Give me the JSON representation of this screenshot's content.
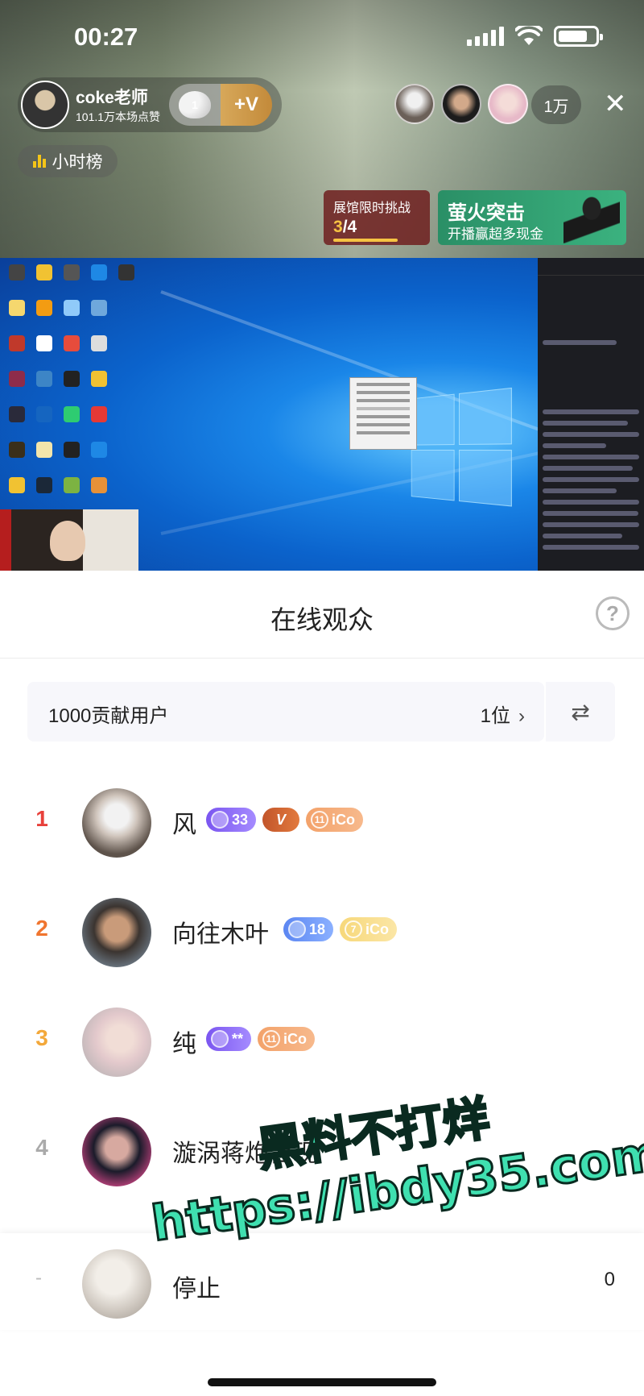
{
  "status_bar": {
    "time": "00:27"
  },
  "host": {
    "name": "coke老师",
    "sub": "101.1万本场点赞",
    "like_level": "1",
    "follow_label": "+V"
  },
  "viewer_count": "1万",
  "hour_rank_label": "小时榜",
  "challenge": {
    "title": "展馆限时挑战",
    "progress_done": "3",
    "progress_total": "/4"
  },
  "promo": {
    "title": "萤火突击",
    "subtitle": "开播赢超多现金"
  },
  "sheet": {
    "title": "在线观众",
    "contributors_label": "1000贡献用户",
    "contributors_count": "1位",
    "rows": [
      {
        "rank": "1",
        "name": "风",
        "level": "33",
        "vip": "V",
        "coin_label": "iCo",
        "coin_num": "11"
      },
      {
        "rank": "2",
        "name": "向往木叶",
        "level": "18",
        "coin_label": "iCo",
        "coin_num": "7"
      },
      {
        "rank": "3",
        "name": "纯",
        "level": "**",
        "coin_label": "iCo",
        "coin_num": "11"
      },
      {
        "rank": "4",
        "name": "漩涡蒋炮台现"
      }
    ],
    "self_row": {
      "rank": "-",
      "name": "停止",
      "score": "0"
    }
  },
  "watermark": {
    "line1": "黑料不打烊",
    "line2": "https://ibdy35.com"
  },
  "colors": {
    "rank1": "#e8413b",
    "rank2": "#f0752f",
    "rank3": "#f3a83a",
    "rank_other": "#aaaaaa"
  }
}
